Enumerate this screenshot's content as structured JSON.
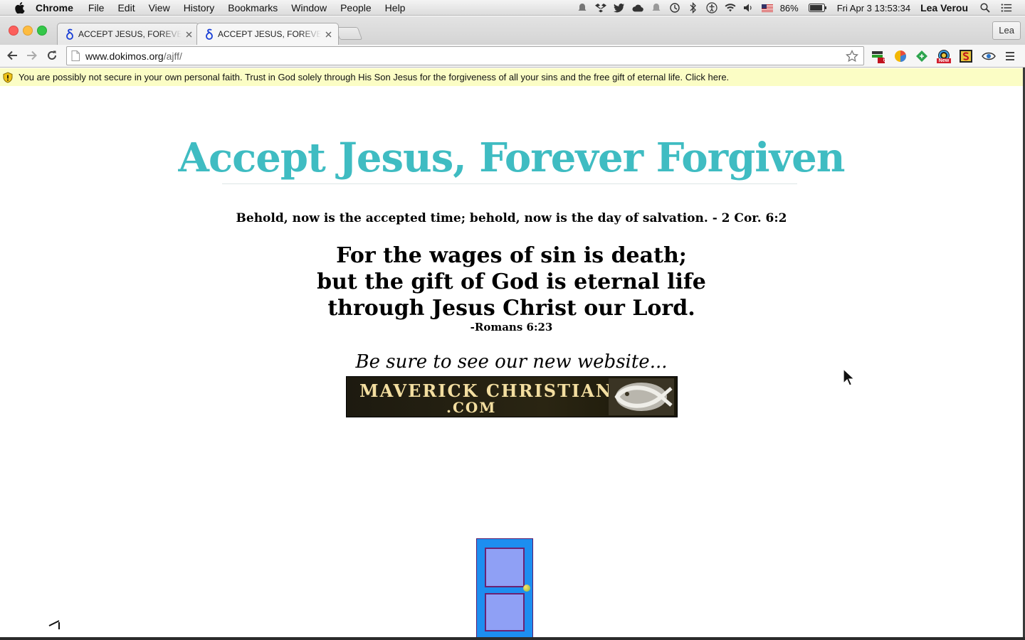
{
  "menubar": {
    "app_name": "Chrome",
    "menus": [
      "File",
      "Edit",
      "View",
      "History",
      "Bookmarks",
      "Window",
      "People",
      "Help"
    ],
    "battery_percent": "86%",
    "datetime": "Fri Apr 3  13:53:34",
    "user": "Lea Verou"
  },
  "tabs": [
    {
      "title": "ACCEPT JESUS, FOREVER FORGIVEN",
      "active": false
    },
    {
      "title": "ACCEPT JESUS, FOREVER FORGIVEN",
      "active": true
    }
  ],
  "profile_button": "Lea",
  "address_bar": {
    "host": "www.dokimos.org",
    "path": "/ajff/"
  },
  "extension_badges": {
    "first": "6",
    "fourth": "New"
  },
  "banner": {
    "text": "You are possibly not secure in your own personal faith. Trust in God solely through His Son Jesus for the forgiveness of all your sins and the free gift of eternal life. Click here."
  },
  "page": {
    "title": "Accept Jesus, Forever Forgiven",
    "verse_line": "Behold, now is the accepted time; behold, now is the day of salvation. - 2 Cor. 6:2",
    "big_verse": [
      "For the wages of sin is death;",
      "but the gift of God is eternal life",
      "through Jesus Christ our Lord."
    ],
    "big_verse_ref": "-Romans 6:23",
    "see_site": "Be sure to see our new website...",
    "banner_ad": {
      "line1": "MAVERICK CHRISTIANS",
      "line2": ".COM"
    }
  },
  "colors": {
    "title": "#3fbcc2",
    "banner_bg": "#fbfdc5",
    "door": "#1d8ef0"
  }
}
